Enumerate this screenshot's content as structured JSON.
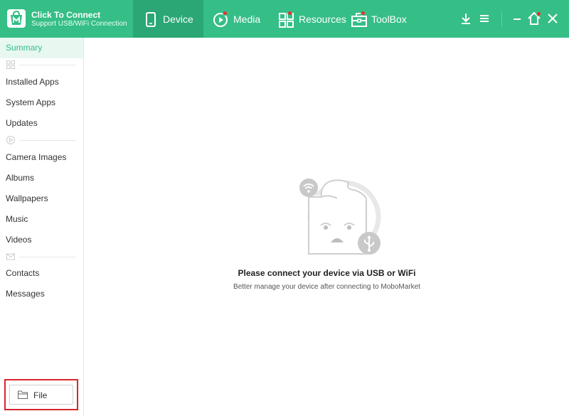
{
  "header": {
    "brand_title": "Click To Connect",
    "brand_subtitle": "Support USB/WiFi Connection",
    "tabs": [
      {
        "label": "Device",
        "icon": "phone-icon",
        "active": true,
        "badge": false
      },
      {
        "label": "Media",
        "icon": "play-icon",
        "active": false,
        "badge": true
      },
      {
        "label": "Resources",
        "icon": "grid-icon",
        "active": false,
        "badge": true
      },
      {
        "label": "ToolBox",
        "icon": "toolbox-icon",
        "active": false,
        "badge": true
      }
    ],
    "actions": [
      "download-icon",
      "menu-icon",
      "minimize-icon",
      "home-icon",
      "close-icon"
    ],
    "accent_color": "#35be86",
    "badge_color": "#e6312f"
  },
  "sidebar": {
    "items": [
      {
        "label": "Summary",
        "active": true
      },
      {
        "label": "Installed Apps"
      },
      {
        "label": "System Apps"
      },
      {
        "label": "Updates"
      },
      {
        "label": "Camera Images"
      },
      {
        "label": "Albums"
      },
      {
        "label": "Wallpapers"
      },
      {
        "label": "Music"
      },
      {
        "label": "Videos"
      },
      {
        "label": "Contacts"
      },
      {
        "label": "Messages"
      }
    ],
    "group_icons": [
      "apps-group-icon",
      "media-group-icon",
      "message-group-icon"
    ],
    "file_button": "File"
  },
  "main": {
    "title": "Please connect your device via USB or WiFi",
    "subtitle": "Better manage your device after connecting to MoboMarket",
    "illustration_icons": [
      "wifi-icon",
      "usb-icon"
    ]
  }
}
